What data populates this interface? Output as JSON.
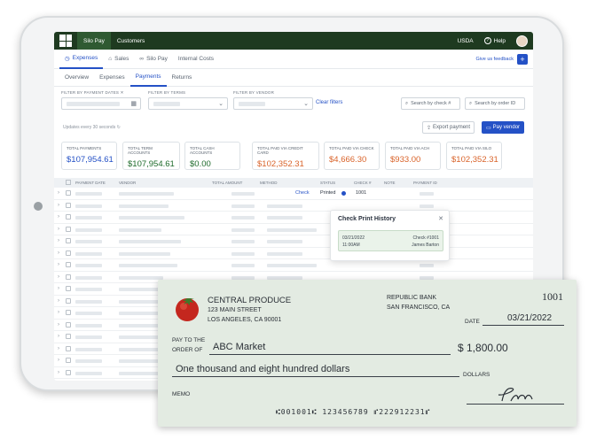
{
  "app": {
    "topnav": [
      "Silo Pay",
      "Customers"
    ],
    "currency": "USDA",
    "help": "Help"
  },
  "tabs": [
    {
      "label": "Expenses",
      "icon": "clock-icon"
    },
    {
      "label": "Sales",
      "icon": "bag-icon"
    },
    {
      "label": "Silo Pay",
      "icon": "link-icon"
    },
    {
      "label": "Internal Costs",
      "icon": ""
    }
  ],
  "feedback": "Give us feedback",
  "subtabs": [
    "Overview",
    "Expenses",
    "Payments",
    "Returns"
  ],
  "filters": {
    "payment_dates": "FILTER BY PAYMENT DATES",
    "terms": "FILTER BY TERMS",
    "vendor": "FILTER BY VENDOR",
    "clear": "Clear filters",
    "search_check": "Search by check #",
    "search_order": "Search by order ID"
  },
  "updates": "Updates every 30 seconds",
  "actions": {
    "export": "Export payment",
    "pay_vendor": "Pay vendor"
  },
  "cards": [
    {
      "label": "TOTAL PAYMENTS",
      "value": "$107,954.61",
      "color": "#2451c6"
    },
    {
      "label": "TOTAL TERM ACCOUNTS",
      "value": "$107,954.61",
      "color": "#1e6b2b"
    },
    {
      "label": "TOTAL CASH ACCOUNTS",
      "value": "$0.00",
      "color": "#1e6b2b"
    },
    {
      "label": "TOTAL PAID VIA CREDIT CARD",
      "value": "$102,352.31",
      "color": "#d9632a"
    },
    {
      "label": "TOTAL PAID VIA CHECK",
      "value": "$4,666.30",
      "color": "#d9632a"
    },
    {
      "label": "TOTAL PAID VIA ACH",
      "value": "$933.00",
      "color": "#d9632a"
    },
    {
      "label": "TOTAL PAID VIA SILO",
      "value": "$102,352.31",
      "color": "#d9632a"
    }
  ],
  "table": {
    "headers": [
      "PAYMENT DATE",
      "VENDOR",
      "TOTAL AMOUNT",
      "METHOD",
      "STATUS",
      "CHECK #",
      "NOTE",
      "PAYMENT ID"
    ],
    "first_row": {
      "method": "Check",
      "status": "Printed",
      "check": "1001"
    }
  },
  "popup": {
    "title": "Check Print History",
    "date": "03/21/2022",
    "time": "11:00AM",
    "check": "Check #1001",
    "by": "James Barton"
  },
  "check": {
    "payer_name": "CENTRAL PRODUCE",
    "payer_addr1": "123 MAIN STREET",
    "payer_addr2": "LOS ANGELES, CA 90001",
    "bank": "REPUBLIC BANK",
    "bank_city": "SAN FRANCISCO, CA",
    "number": "1001",
    "date_label": "DATE",
    "date": "03/21/2022",
    "pay_to_label1": "PAY TO THE",
    "pay_to_label2": "ORDER OF",
    "payee": "ABC Market",
    "amount": "$ 1,800.00",
    "amount_words": "One thousand and eight hundred dollars",
    "dollars": "DOLLARS",
    "memo": "MEMO",
    "micr": "⑆001001⑆ 123456789 ⑈222912231⑈"
  }
}
